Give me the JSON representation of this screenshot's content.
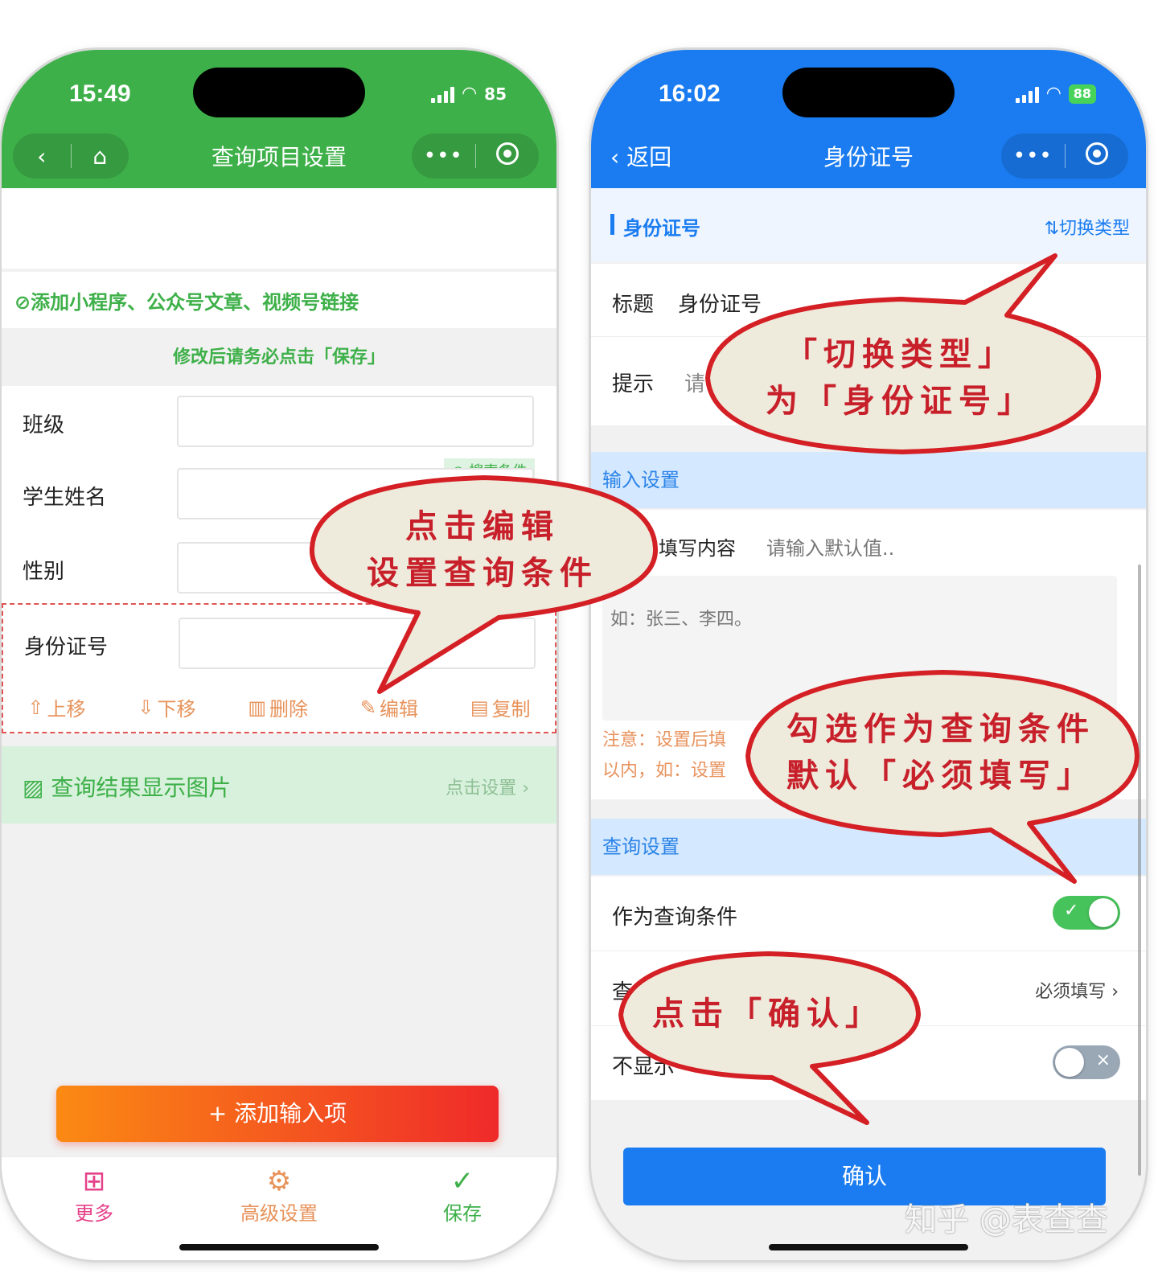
{
  "left": {
    "status": {
      "time": "15:49",
      "battery": "85"
    },
    "nav": {
      "back_icon": "‹",
      "home_icon": "⌂",
      "title": "查询项目设置",
      "more": "•••"
    },
    "link_notice": "⊘添加小程序、公众号文章、视频号链接",
    "save_hint": "修改后请务必点击「保存」",
    "fields": [
      {
        "label": "班级"
      },
      {
        "label": "学生姓名"
      },
      {
        "label": "性别"
      },
      {
        "label": "身份证号"
      }
    ],
    "search_tag": "○ 搜索条件",
    "actions": {
      "up": "上移",
      "down": "下移",
      "delete": "删除",
      "edit": "编辑",
      "copy": "复制"
    },
    "result_image": {
      "label": "查询结果显示图片",
      "action": "点击设置 ›"
    },
    "add_button": "+ 添加输入项",
    "tabs": {
      "more": "更多",
      "advanced": "高级设置",
      "save": "保存"
    }
  },
  "right": {
    "status": {
      "time": "16:02",
      "battery": "88"
    },
    "nav": {
      "back": "‹  返回",
      "title": "身份证号",
      "more": "•••"
    },
    "section_title": "身份证号",
    "switch_type": "⇅切换类型",
    "title_row": {
      "label": "标题",
      "value": "身份证号"
    },
    "hint_row": {
      "label": "提示",
      "value": "请"
    },
    "input_settings": "输入设置",
    "default_row": {
      "label": "填写内容",
      "placeholder": "请输入默认值.."
    },
    "example_text": "如：张三、李四。",
    "note_line1": "注意：设置后填",
    "note_line2": "以内，如：设置",
    "query_settings": "查询设置",
    "as_condition": "作为查询条件",
    "query_row": {
      "label": "查",
      "value": "必须填写 ›"
    },
    "hide_row": {
      "label": "不显示"
    },
    "confirm": "确认"
  },
  "callouts": {
    "c1": [
      "点击编辑",
      "设置查询条件"
    ],
    "c2": [
      "「切换类型」",
      "为「身份证号」"
    ],
    "c3": [
      "勾选作为查询条件",
      "默认「必须填写」"
    ],
    "c4": [
      "点击「确认」"
    ]
  },
  "watermark": "知乎 @表查查",
  "colors": {
    "green": "#3eb049",
    "blue": "#1a7cf0",
    "red": "#c8202a",
    "orange": "#e7925a"
  }
}
